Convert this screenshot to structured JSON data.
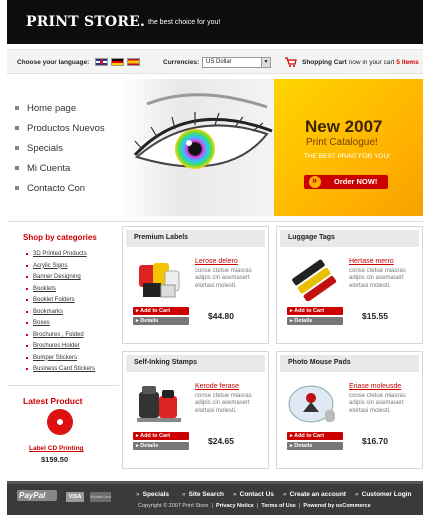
{
  "header": {
    "logo": "PRINT STORE.",
    "tagline": "the best choice for you!"
  },
  "toolbar": {
    "language_label": "Choose your language:",
    "currency_label": "Currencies:",
    "currency_selected": "US Dollar",
    "cart_label": "Shopping Cart",
    "cart_text": "now in your cart",
    "cart_count": "5 items"
  },
  "menu": {
    "items": [
      "Home page",
      "Productos Nuevos",
      "Specials",
      "Mi Cuenta",
      "Contacto Con"
    ]
  },
  "promo": {
    "headline": "New 2007",
    "subline": "Print Catalogue!",
    "tag": "THE BEST PRINT FOR YOU!",
    "button": "Order NOW!"
  },
  "sidebar": {
    "title": "Shop by categories",
    "categories": [
      "3D Printed Products",
      "Acrylic Signs",
      "Banner Designing",
      "Booklets",
      "Booklet Folders",
      "Bookmarks",
      "Boxes",
      "Brochures , Folded",
      "Brochures Holder",
      "Bumper Stickers",
      "Business Card Stickers"
    ]
  },
  "latest": {
    "title": "Latest Product",
    "name": "Label CD Printing",
    "price": "$159.50"
  },
  "products": [
    {
      "category": "Premium Labels",
      "name": "Lerose delero",
      "desc": "conse ctetue miasras adipis cin asemasert elortasi molesti.",
      "price": "$44.80",
      "add": "Add to Cart",
      "details": "Details"
    },
    {
      "category": "Luggage Tags",
      "name": "Hertase merro",
      "desc": "conse ctetue miasras adipis cin asemasert elortasi molesti.",
      "price": "$15.55",
      "add": "Add to Cart",
      "details": "Details"
    },
    {
      "category": "Self-Inking Stamps",
      "name": "Kerode ferase",
      "desc": "conse ctetue miasras adipis cin asemasert elortasi molesti.",
      "price": "$24.65",
      "add": "Add to Cart",
      "details": "Details"
    },
    {
      "category": "Photo Mouse Pads",
      "name": "Eriase moleusde",
      "desc": "conse ctetue miasras adipis cin asemasert elortasi molesti.",
      "price": "$16.70",
      "add": "Add to Cart",
      "details": "Details"
    }
  ],
  "footer": {
    "payment": {
      "paypal": "PayPal",
      "visa": "VISA",
      "mastercard": "MasterCard"
    },
    "links": [
      "Specials",
      "Site Search",
      "Contact Us",
      "Create an account",
      "Customer Login"
    ],
    "copyright": "Copyright © 2007 Print Store",
    "privacy": "Privacy Notice",
    "terms": "Terms of Use",
    "powered": "Powered by osCommerce"
  },
  "colors": {
    "accent": "#cc0000",
    "promo": "#ffc400",
    "header": "#0d0d0d",
    "footer": "#3a3a3a"
  }
}
